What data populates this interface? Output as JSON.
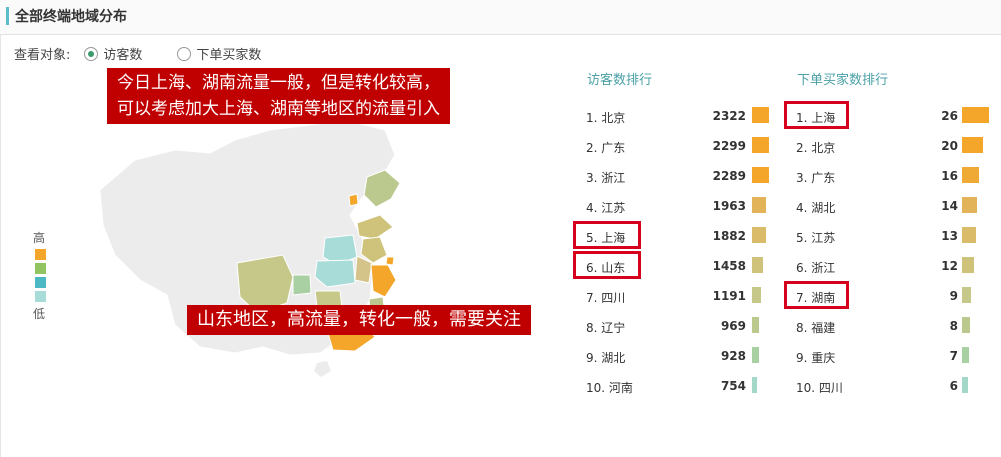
{
  "header": {
    "title": "全部终端地域分布"
  },
  "viewby": {
    "label": "查看对象:",
    "options": [
      {
        "label": "访客数",
        "checked": true
      },
      {
        "label": "下单买家数",
        "checked": false
      }
    ]
  },
  "legend": {
    "high": "高",
    "low": "低",
    "colors": [
      "#f4a62a",
      "#93c462",
      "#4cb8c4",
      "#a8dcd8"
    ]
  },
  "annotations": {
    "top_line1": "今日上海、湖南流量一般，但是转化较高，",
    "top_line2": "可以考虑加大上海、湖南等地区的流量引入",
    "bottom": "山东地区，高流量，转化一般，需要关注"
  },
  "visitors": {
    "title": "访客数排行",
    "rows": [
      {
        "name": "1. 北京",
        "value": "2322",
        "level": 1.0,
        "color": "#f4a62a",
        "highlight": false
      },
      {
        "name": "2. 广东",
        "value": "2299",
        "level": 0.99,
        "color": "#f4a62a",
        "highlight": false
      },
      {
        "name": "3. 浙江",
        "value": "2289",
        "level": 0.98,
        "color": "#f4a62a",
        "highlight": false
      },
      {
        "name": "4. 江苏",
        "value": "1963",
        "level": 0.84,
        "color": "#e3b35a",
        "highlight": false
      },
      {
        "name": "5. 上海",
        "value": "1882",
        "level": 0.81,
        "color": "#d9bb6a",
        "highlight": true
      },
      {
        "name": "6. 山东",
        "value": "1458",
        "level": 0.63,
        "color": "#cfc27a",
        "highlight": true
      },
      {
        "name": "7. 四川",
        "value": "1191",
        "level": 0.51,
        "color": "#c6c889",
        "highlight": false
      },
      {
        "name": "8. 辽宁",
        "value": "969",
        "level": 0.42,
        "color": "#bcc98e",
        "highlight": false
      },
      {
        "name": "9. 湖北",
        "value": "928",
        "level": 0.4,
        "color": "#a9d0a3",
        "highlight": false
      },
      {
        "name": "10. 河南",
        "value": "754",
        "level": 0.32,
        "color": "#a3d8c8",
        "highlight": false
      }
    ]
  },
  "buyers": {
    "title": "下单买家数排行",
    "rows": [
      {
        "name": "1. 上海",
        "value": "26",
        "level": 1.0,
        "color": "#f4a62a",
        "highlight": true
      },
      {
        "name": "2. 北京",
        "value": "20",
        "level": 0.77,
        "color": "#f4a62a",
        "highlight": false
      },
      {
        "name": "3. 广东",
        "value": "16",
        "level": 0.62,
        "color": "#efaa35",
        "highlight": false
      },
      {
        "name": "4. 湖北",
        "value": "14",
        "level": 0.54,
        "color": "#e3b35a",
        "highlight": false
      },
      {
        "name": "5. 江苏",
        "value": "13",
        "level": 0.5,
        "color": "#d9bb6a",
        "highlight": false
      },
      {
        "name": "6. 浙江",
        "value": "12",
        "level": 0.46,
        "color": "#cfc27a",
        "highlight": false
      },
      {
        "name": "7. 湖南",
        "value": "9",
        "level": 0.35,
        "color": "#c6c889",
        "highlight": true
      },
      {
        "name": "8. 福建",
        "value": "8",
        "level": 0.31,
        "color": "#bcc98e",
        "highlight": false
      },
      {
        "name": "9. 重庆",
        "value": "7",
        "level": 0.27,
        "color": "#a9d0a3",
        "highlight": false
      },
      {
        "name": "10. 四川",
        "value": "6",
        "level": 0.23,
        "color": "#a3d8c8",
        "highlight": false
      }
    ]
  }
}
